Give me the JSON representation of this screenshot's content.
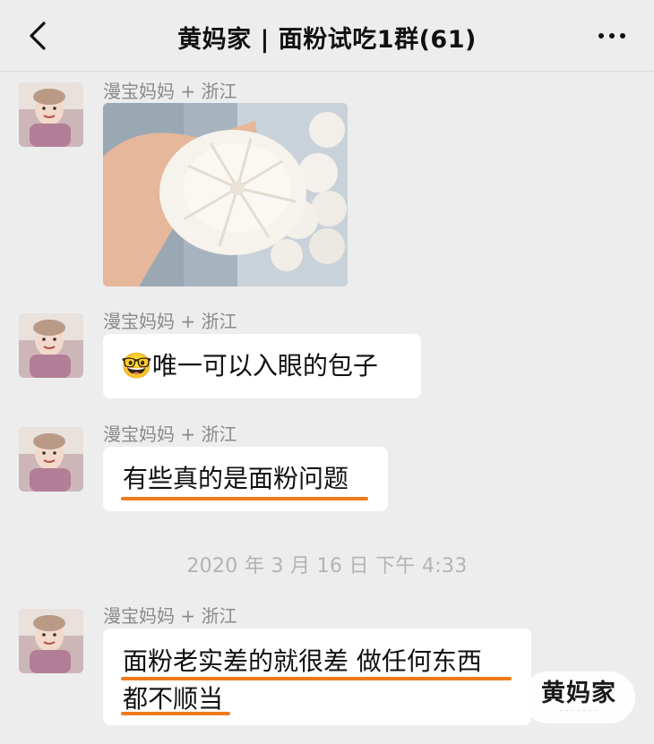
{
  "header": {
    "back_icon": "chevron-left-icon",
    "title": "黄妈家 | 面粉试吃1群(61)",
    "more_icon": "more-dots-icon"
  },
  "messages": [
    {
      "sender": "漫宝妈妈 + 浙江",
      "type": "image",
      "image_desc": "photo-of-steamed-bun"
    },
    {
      "sender": "漫宝妈妈 + 浙江",
      "type": "text",
      "emoji": "🤓",
      "text": "唯一可以入眼的包子"
    },
    {
      "sender": "漫宝妈妈 + 浙江",
      "type": "text",
      "text": "有些真的是面粉问题"
    },
    {
      "sender": "漫宝妈妈 + 浙江",
      "type": "text",
      "lines": [
        "面粉老实差的就很差 做任何东西",
        "都不顺当"
      ]
    }
  ],
  "timestamp": "2020 年 3 月 16 日 下午 4:33",
  "watermark": {
    "brand": "黄妈家"
  },
  "colors": {
    "background": "#ededed",
    "bubble": "#ffffff",
    "underline": "#f07a1c",
    "meta_text": "#8a8a8a"
  }
}
